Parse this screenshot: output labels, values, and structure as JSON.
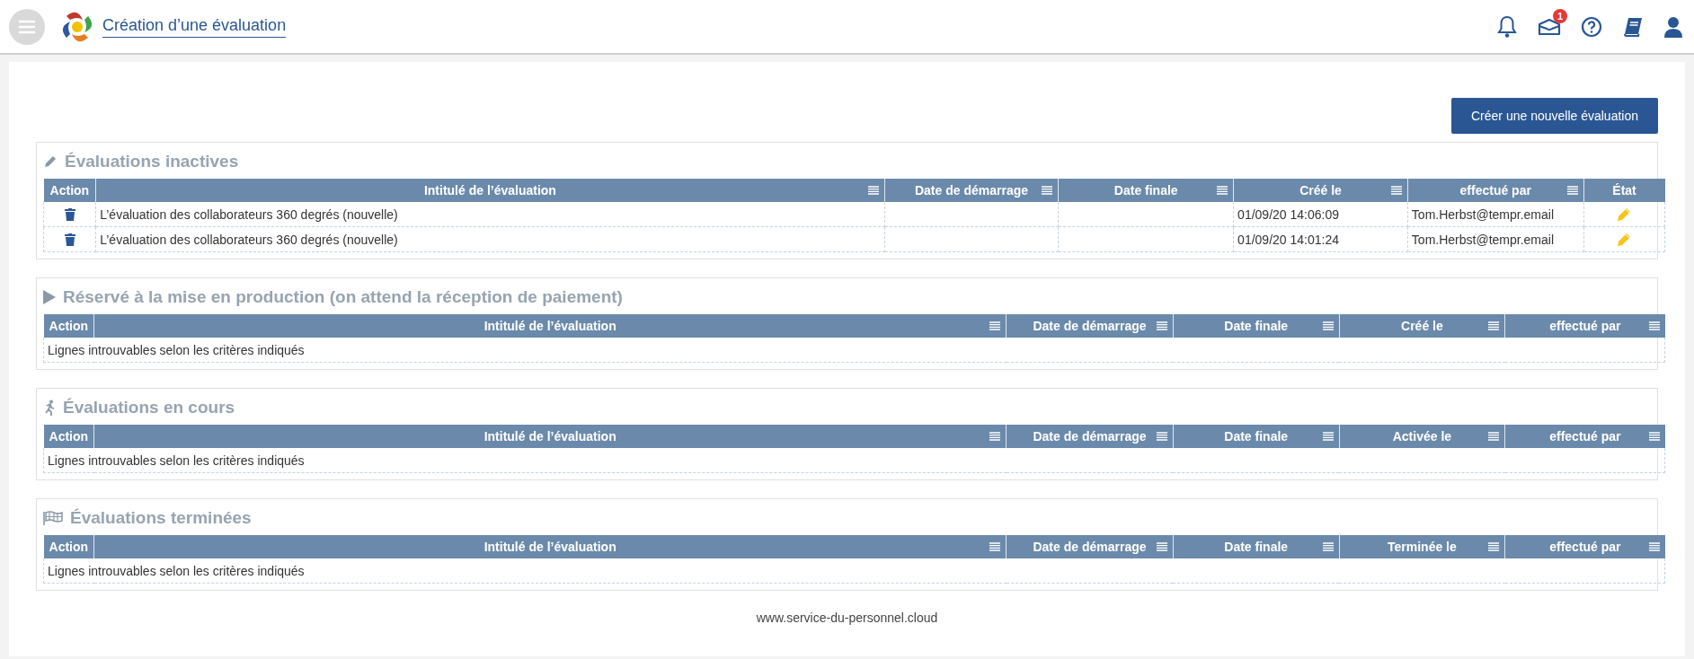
{
  "header": {
    "title": "Création d’une évaluation",
    "inbox_badge": "1"
  },
  "create_button": "Créer une nouvelle évaluation",
  "sections": [
    {
      "kind": "inactive",
      "title": "Évaluations inactives",
      "columns": [
        {
          "kind": "action",
          "label": "Action",
          "menu": false
        },
        {
          "kind": "title",
          "label": "Intitulé de l’évaluation",
          "menu": true
        },
        {
          "kind": "start",
          "label": "Date de démarrage",
          "menu": true
        },
        {
          "kind": "end",
          "label": "Date finale",
          "menu": true
        },
        {
          "kind": "created",
          "label": "Créé le",
          "menu": true
        },
        {
          "kind": "by",
          "label": "effectué par",
          "menu": true
        },
        {
          "kind": "status",
          "label": "État",
          "menu": false
        }
      ],
      "rows": [
        {
          "title": "L’évaluation des collaborateurs 360 degrés (nouvelle)",
          "created": "01/09/20 14:06:09",
          "by": "Tom.Herbst@tempr.email"
        },
        {
          "title": "L’évaluation des collaborateurs 360 degrés (nouvelle)",
          "created": "01/09/20 14:01:24",
          "by": "Tom.Herbst@tempr.email"
        }
      ]
    },
    {
      "kind": "reserved",
      "title": "Réservé à la mise en production (on attend la réception de paiement)",
      "columns": [
        {
          "kind": "action",
          "label": "Action",
          "menu": false
        },
        {
          "kind": "title",
          "label": "Intitulé de l’évaluation",
          "menu": true
        },
        {
          "kind": "start",
          "label": "Date de démarrage",
          "menu": true
        },
        {
          "kind": "end",
          "label": "Date finale",
          "menu": true
        },
        {
          "kind": "created",
          "label": "Créé le",
          "menu": true
        },
        {
          "kind": "by",
          "label": "effectué par",
          "menu": true
        }
      ],
      "empty_message": "Lignes introuvables selon les critères indiqués"
    },
    {
      "kind": "running",
      "title": "Évaluations en cours",
      "columns": [
        {
          "kind": "action",
          "label": "Action",
          "menu": false
        },
        {
          "kind": "title",
          "label": "Intitulé de l’évaluation",
          "menu": true
        },
        {
          "kind": "start",
          "label": "Date de démarrage",
          "menu": true
        },
        {
          "kind": "end",
          "label": "Date finale",
          "menu": true
        },
        {
          "kind": "activated",
          "label": "Activée le",
          "menu": true
        },
        {
          "kind": "by",
          "label": "effectué par",
          "menu": true
        }
      ],
      "empty_message": "Lignes introuvables selon les critères indiqués"
    },
    {
      "kind": "finished",
      "title": "Évaluations terminées",
      "columns": [
        {
          "kind": "action",
          "label": "Action",
          "menu": false
        },
        {
          "kind": "title",
          "label": "Intitulé de l’évaluation",
          "menu": true
        },
        {
          "kind": "start",
          "label": "Date de démarrage",
          "menu": true
        },
        {
          "kind": "end",
          "label": "Date finale",
          "menu": true
        },
        {
          "kind": "finished",
          "label": "Terminée le",
          "menu": true
        },
        {
          "kind": "by",
          "label": "effectué par",
          "menu": true
        }
      ],
      "empty_message": "Lignes introuvables selon les critères indiqués"
    }
  ],
  "footer": "www.service-du-personnel.cloud"
}
